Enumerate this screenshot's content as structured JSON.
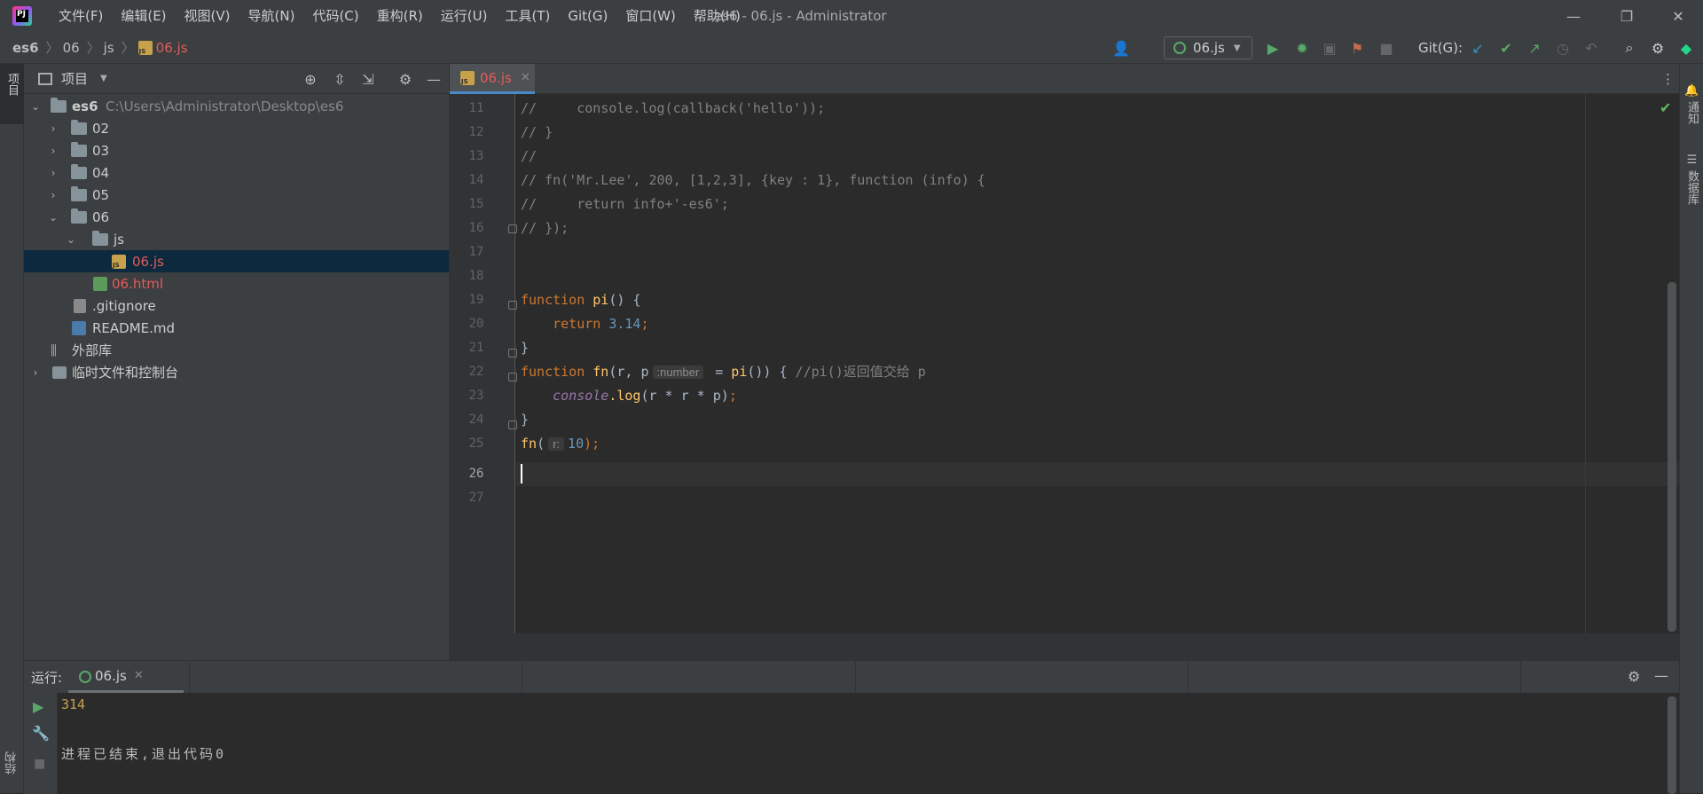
{
  "titlebar": {
    "menu": [
      "文件(F)",
      "编辑(E)",
      "视图(V)",
      "导航(N)",
      "代码(C)",
      "重构(R)",
      "运行(U)",
      "工具(T)",
      "Git(G)",
      "窗口(W)",
      "帮助(H)"
    ],
    "title": "es6 - 06.js - Administrator",
    "minimize": "—",
    "restore": "❐",
    "close": "✕"
  },
  "breadcrumb": {
    "items": [
      "es6",
      "06",
      "js",
      "06.js"
    ],
    "sep": "〉"
  },
  "toolbar": {
    "run_config": "06.js",
    "git_label": "Git(G):"
  },
  "left_strip": {
    "project_tab": "项目",
    "structure_tab": "结构"
  },
  "right_strip": {
    "notifications": "通知",
    "database": "数据库"
  },
  "project_panel": {
    "title": "项目",
    "tree": [
      {
        "label": "es6",
        "path": "C:\\Users\\Administrator\\Desktop\\es6"
      },
      {
        "label": "02"
      },
      {
        "label": "03"
      },
      {
        "label": "04"
      },
      {
        "label": "05"
      },
      {
        "label": "06"
      },
      {
        "label": "js"
      },
      {
        "label": "06.js"
      },
      {
        "label": "06.html"
      },
      {
        "label": ".gitignore"
      },
      {
        "label": "README.md"
      },
      {
        "label": "外部库"
      },
      {
        "label": "临时文件和控制台"
      }
    ]
  },
  "editor": {
    "tab": "06.js",
    "line_numbers": [
      "11",
      "12",
      "13",
      "14",
      "15",
      "16",
      "17",
      "18",
      "19",
      "20",
      "21",
      "22",
      "23",
      "24",
      "25",
      "26",
      "27"
    ],
    "lines": {
      "l11": "//     console.log(callback('hello'));",
      "l12": "// }",
      "l13": "//",
      "l14": "// fn('Mr.Lee', 200, [1,2,3], {key : 1}, function (info) {",
      "l15": "//     return info+'-es6';",
      "l16": "// });",
      "kw_function": "function",
      "kw_return": "return",
      "fn_pi": "pi",
      "fn_fn": "fn",
      "paren_pi": "() {",
      "num_314": "3.14",
      "semi": ";",
      "brace_close": "}",
      "params_open": "(r, p",
      "inlay_number": ":number",
      "assign": " = ",
      "call_pi": "pi",
      "call_rest": "()) { ",
      "comment22": "//pi()返回值交给 p",
      "console": "console",
      "log": ".log",
      "log_args": "(r * r * p)",
      "fn_call": "fn",
      "fn_call_open": "(",
      "inlay_r": "r:",
      "num_10": "10",
      "fn_call_close": ");"
    }
  },
  "run_panel": {
    "label": "运行:",
    "tab": "06.js",
    "output": [
      "314",
      "进程已结束,退出代码0"
    ]
  },
  "colors": {
    "accent": "#4a88c7",
    "error_file": "#e05d5d",
    "run_green": "#59a869"
  }
}
